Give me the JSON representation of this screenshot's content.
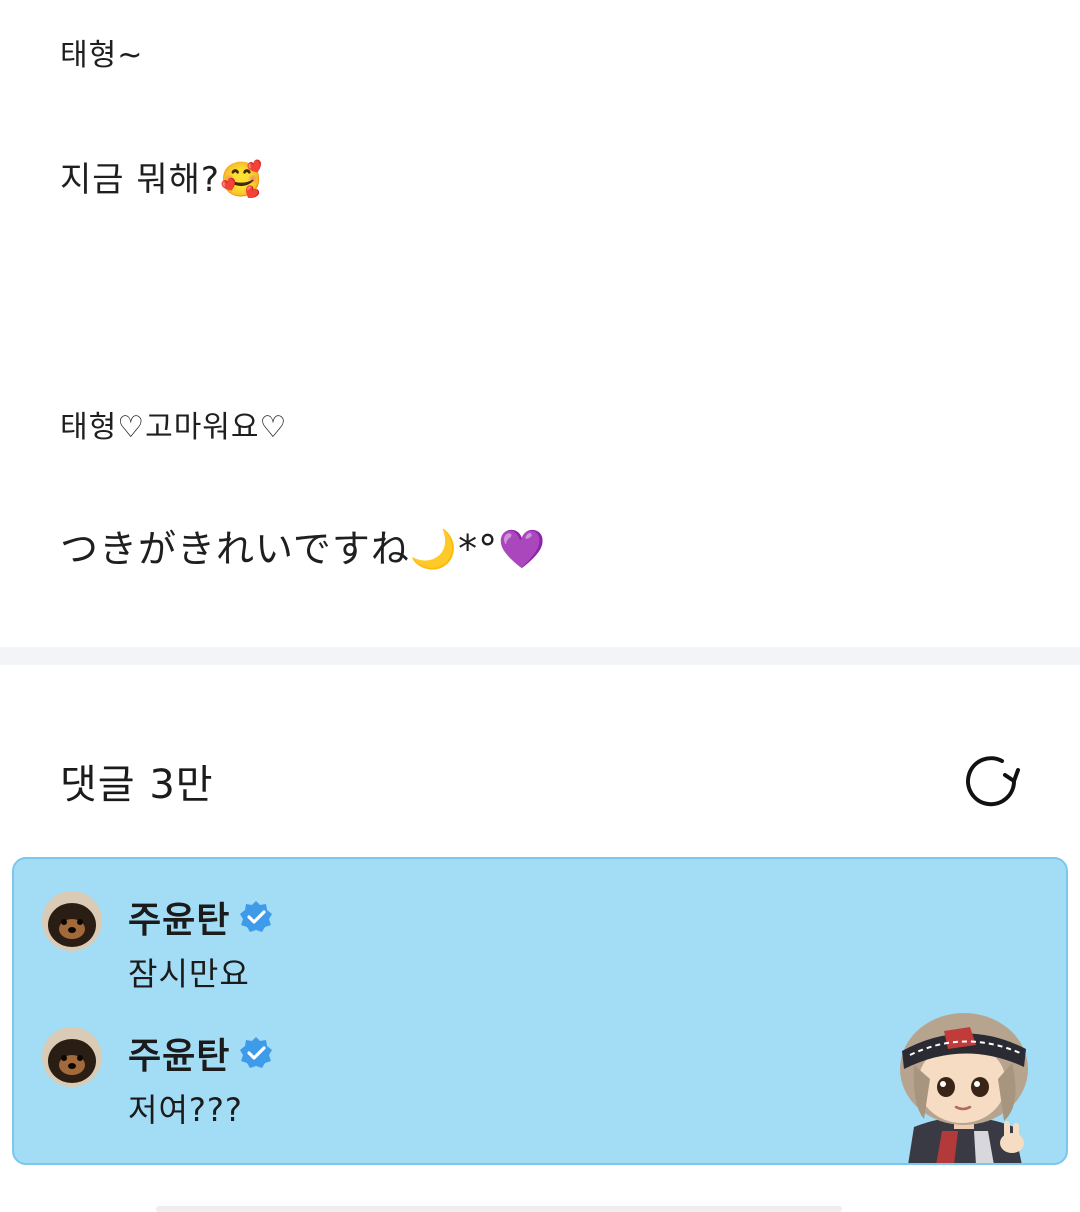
{
  "post": {
    "lines": [
      "태형~",
      "지금 뭐해?🥰",
      "태형♡고마워요♡",
      "つきがきれいですね🌙*°💜"
    ]
  },
  "comments_section": {
    "header": "댓글 3만",
    "refresh_icon": "refresh-icon",
    "panel_bg": "#a3dcf5",
    "verified_color": "#3d9be9",
    "comments": [
      {
        "author": "주윤탄",
        "verified": true,
        "text": "잠시만요"
      },
      {
        "author": "주윤탄",
        "verified": true,
        "text": "저여???"
      }
    ]
  }
}
